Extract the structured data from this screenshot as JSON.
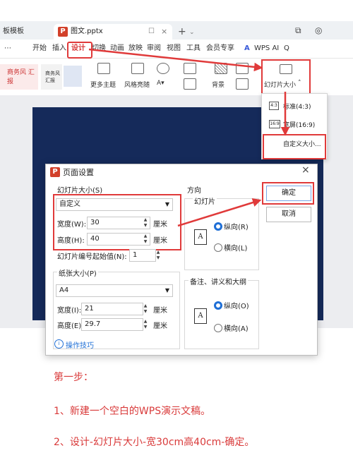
{
  "window": {
    "other_tab": "板模板",
    "active_tab": {
      "icon": "P",
      "title": "图文.pptx",
      "pin": "☐",
      "close": "×"
    },
    "new_tab": "+",
    "new_tab_arrow": "⌄",
    "right_icons": [
      "⧉",
      "◎"
    ]
  },
  "menu": {
    "items": [
      "开始",
      "插入",
      "设计",
      "切换",
      "动画",
      "放映",
      "审阅",
      "视图",
      "工具",
      "会员专享",
      "WPS AI"
    ],
    "search_icon": "Q"
  },
  "ribbon": {
    "more_themes": "更多主题",
    "style_replace": "风格亮随",
    "background": "背景",
    "slide_size": "幻灯片大小",
    "thumb_label_1": "商务风\n汇报",
    "thumb_label_2": "商务风\n汇报"
  },
  "dropdown": {
    "items": [
      "标准(4:3)",
      "宽屏(16:9)",
      "自定义大小..."
    ]
  },
  "dialog": {
    "icon": "P",
    "title": "页面设置",
    "close": "×",
    "slide_size_group": "幻灯片大小(S)",
    "slide_size_value": "自定义",
    "width_label": "宽度(W):",
    "width_value": "30",
    "height_label": "高度(H):",
    "height_value": "40",
    "unit": "厘米",
    "start_number_label": "幻灯片编号起始值(N):",
    "start_number_value": "1",
    "paper_group": "纸张大小(P)",
    "paper_value": "A4",
    "paper_width_label": "宽度(I):",
    "paper_width_value": "21",
    "paper_height_label": "高度(E):",
    "paper_height_value": "29.7",
    "tips": "操作技巧",
    "orientation_group": "方向",
    "slides_label": "幻灯片",
    "portrait": "纵向(R)",
    "landscape": "横向(L)",
    "notes_label": "备注、讲义和大纲",
    "notes_portrait": "纵向(O)",
    "notes_landscape": "横向(A)",
    "ok": "确定",
    "cancel": "取消",
    "page_glyph": "A"
  },
  "instructions": {
    "step": "第一步：",
    "line1": "1、新建一个空白的WPS演示文稿。",
    "line2": "2、设计-幻灯片大小-宽30cm高40cm-确定。"
  },
  "colors": {
    "accent_red": "#e03a3a",
    "wps_red": "#d2402a",
    "slide_bg": "#152a5a",
    "radio_blue": "#1f6fd6"
  }
}
